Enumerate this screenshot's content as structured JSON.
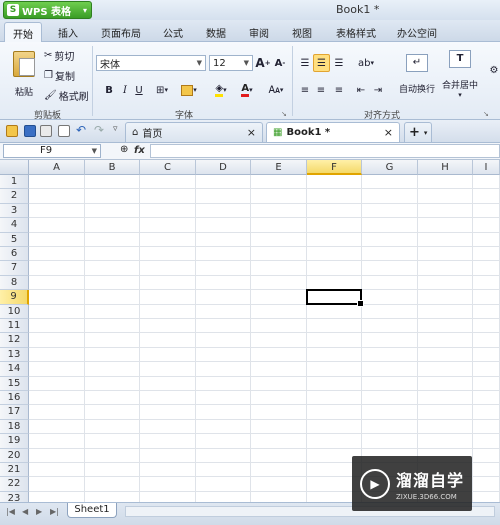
{
  "app": {
    "button_label": "WPS 表格",
    "logo_letter": "S",
    "caret": "▾",
    "doc_title": "Book1 *"
  },
  "tabs": [
    {
      "label": "开始",
      "active": true
    },
    {
      "label": "插入"
    },
    {
      "label": "页面布局"
    },
    {
      "label": "公式"
    },
    {
      "label": "数据"
    },
    {
      "label": "审阅"
    },
    {
      "label": "视图"
    },
    {
      "label": "表格样式"
    },
    {
      "label": "办公空间"
    }
  ],
  "ribbon": {
    "clipboard": {
      "paste": "粘贴",
      "cut": "剪切",
      "copy": "复制",
      "format_painter": "格式刷",
      "group_label": "剪贴板"
    },
    "font": {
      "name": "宋体",
      "size": "12",
      "bold": "B",
      "italic": "I",
      "underline": "U",
      "grow": "A",
      "shrink": "A",
      "group_label": "字体"
    },
    "alignment": {
      "wrap": "自动换行",
      "merge": "合并居中",
      "group_label": "对齐方式"
    }
  },
  "doc_tabs": {
    "home": "首页",
    "book": "Book1 *",
    "close": "×",
    "add": "+"
  },
  "formula": {
    "cell_ref": "F9",
    "fx": "fx",
    "value": ""
  },
  "grid": {
    "columns": [
      "A",
      "B",
      "C",
      "D",
      "E",
      "F",
      "G",
      "H",
      "I"
    ],
    "rows": [
      "1",
      "2",
      "3",
      "4",
      "5",
      "6",
      "7",
      "8",
      "9",
      "10",
      "11",
      "12",
      "13",
      "14",
      "15",
      "16",
      "17",
      "18",
      "19",
      "20",
      "21",
      "22",
      "23"
    ],
    "selected_col": "F",
    "selected_row": "9"
  },
  "sheets": [
    {
      "label": "Sheet1"
    }
  ],
  "watermark": {
    "title": "溜溜自学",
    "subtitle": "ZIXUE.3D66.COM"
  }
}
